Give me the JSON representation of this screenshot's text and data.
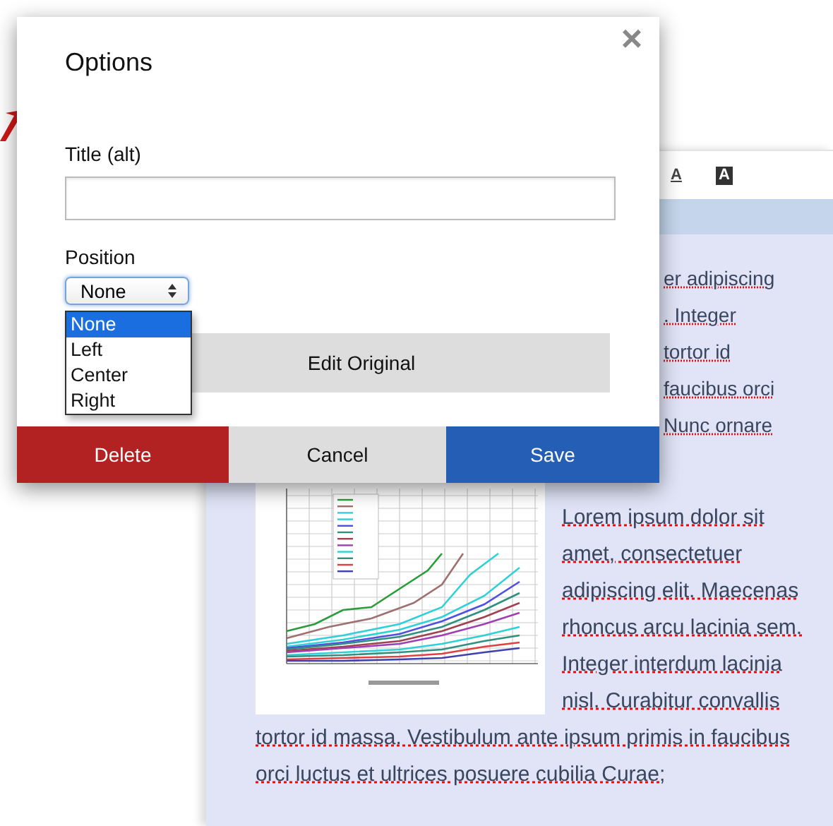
{
  "toolbar": [
    {
      "kind": "underline",
      "glyph": "A"
    },
    {
      "kind": "inverse",
      "glyph": "A"
    }
  ],
  "editor": {
    "partial_lines": [
      "er adipiscing",
      ". Integer",
      "tortor id",
      "faucibus orci",
      "Nunc ornare"
    ],
    "paragraph_beside_image": "Lorem ipsum dolor sit amet, consectetuer adipiscing elit. Maecenas rhoncus arcu lacinia sem. Integer interdum lacinia nisl. Curabitur convallis",
    "paragraph_below_image": "tortor id massa. Vestibulum ante ipsum primis in faucibus orci luctus et ultrices posuere cubilia Curae;"
  },
  "dialog": {
    "title": "Options",
    "close": "×",
    "title_field": {
      "label": "Title (alt)"
    },
    "position": {
      "label": "Position",
      "value": "None",
      "expanded": true,
      "options": [
        {
          "label": "None",
          "selected": true
        },
        {
          "label": "Left",
          "selected": false
        },
        {
          "label": "Center",
          "selected": false
        },
        {
          "label": "Right",
          "selected": false
        }
      ]
    },
    "edit_button": "Edit Original",
    "buttons": [
      {
        "kind": "danger",
        "label": "Delete"
      },
      {
        "kind": "neutral",
        "label": "Cancel"
      },
      {
        "kind": "primary",
        "label": "Save"
      }
    ]
  }
}
